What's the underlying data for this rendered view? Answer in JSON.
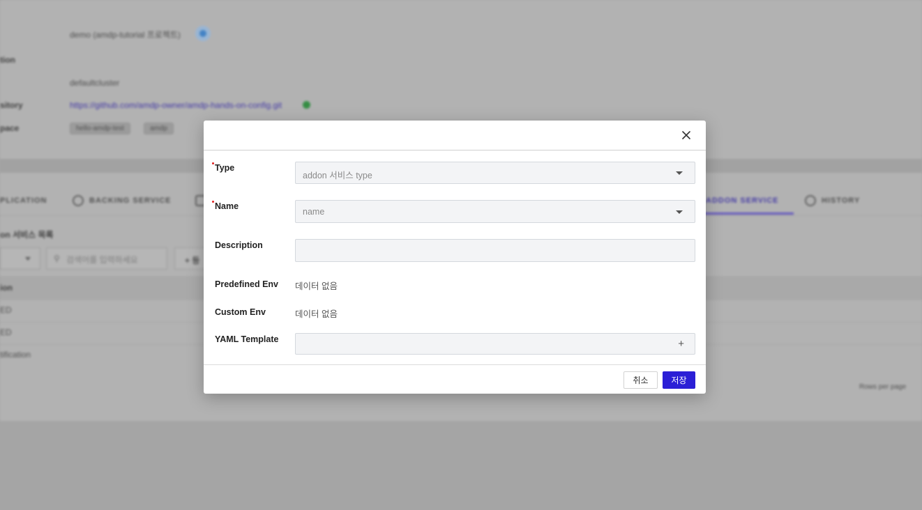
{
  "background": {
    "project_line": "demo (amdp-tutorial 프로젝트)",
    "section_label": "tion",
    "cluster_value": "defaultcluster",
    "repository_label": "sitory",
    "repository_url": "https://github.com/amdp-owner/amdp-hands-on-config.git",
    "space_label": "pace",
    "chips": [
      "hello-amdp-test",
      "amdp"
    ],
    "tabs": [
      "PLICATION",
      "BACKING SERVICE",
      "ADDON SERVICE",
      "HISTORY"
    ],
    "list_title": "on 서비스 목록",
    "search_placeholder": "검색어를 입력하세요",
    "add_label": "+ 등",
    "table_header": "ion",
    "rows": [
      "ED",
      "ED",
      "tification"
    ],
    "rows_per_page": "Rows per page"
  },
  "modal": {
    "close_icon": "close-icon",
    "fields": {
      "type": {
        "label": "Type",
        "placeholder": "addon 서비스 type",
        "required": true
      },
      "name": {
        "label": "Name",
        "placeholder": "name",
        "required": true
      },
      "description": {
        "label": "Description",
        "value": ""
      },
      "predefined_env": {
        "label": "Predefined Env",
        "value": "데이터 없음"
      },
      "custom_env": {
        "label": "Custom Env",
        "value": "데이터 없음"
      },
      "yaml_template": {
        "label": "YAML Template",
        "action_icon": "plus-icon"
      }
    },
    "footer": {
      "cancel_label": "취소",
      "save_label": "저장"
    }
  },
  "colors": {
    "primary": "#2b1fd6",
    "required": "#e02020",
    "input_bg": "#f3f4f6"
  }
}
